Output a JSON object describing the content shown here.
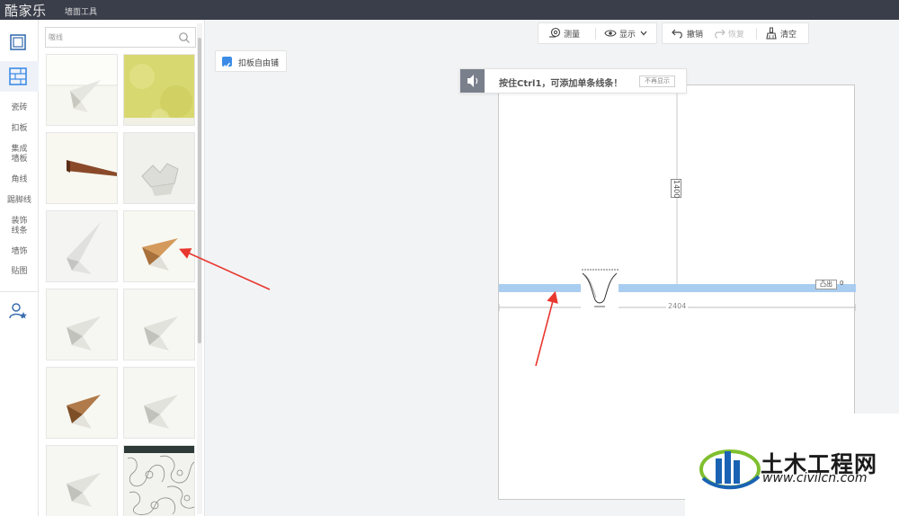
{
  "app": {
    "logo": "酷家乐",
    "subtitle": "墙面工具"
  },
  "sidebar": {
    "items": [
      "瓷砖",
      "扣板",
      "集成\n墙板",
      "角线",
      "踢脚线",
      "装饰\n线条",
      "墙饰",
      "贴图"
    ]
  },
  "panel": {
    "search_placeholder": "嗷线",
    "thumbnails": [
      "white-corner-trim",
      "yellow-texture",
      "brown-trim",
      "white-molding",
      "white-angle-trim",
      "wood-corner-trim",
      "white-corner-trim",
      "white-corner-trim",
      "wood-corner-trim",
      "white-corner-trim",
      "white-corner-trim",
      "lace-pattern"
    ]
  },
  "toolbar": {
    "measure": "测量",
    "display": "显示",
    "undo": "撤销",
    "redo": "恢复",
    "clear": "清空"
  },
  "option": {
    "label": "扣板自由铺",
    "checked": true
  },
  "hint": {
    "text": "按住Ctrl1，可添加单条线条！",
    "dismiss": "不再显示"
  },
  "dimensions": {
    "height": "1400",
    "width": "2404"
  },
  "protrusion": {
    "label": "凸出",
    "value": "0"
  },
  "watermark": {
    "title": "土木工程网",
    "url": "www.civilcn.com"
  },
  "colors": {
    "accent": "#3c8ce7",
    "trim_strip": "#a9cdf0",
    "topbar": "#3a3e4a",
    "arrow": "#e8372f"
  }
}
